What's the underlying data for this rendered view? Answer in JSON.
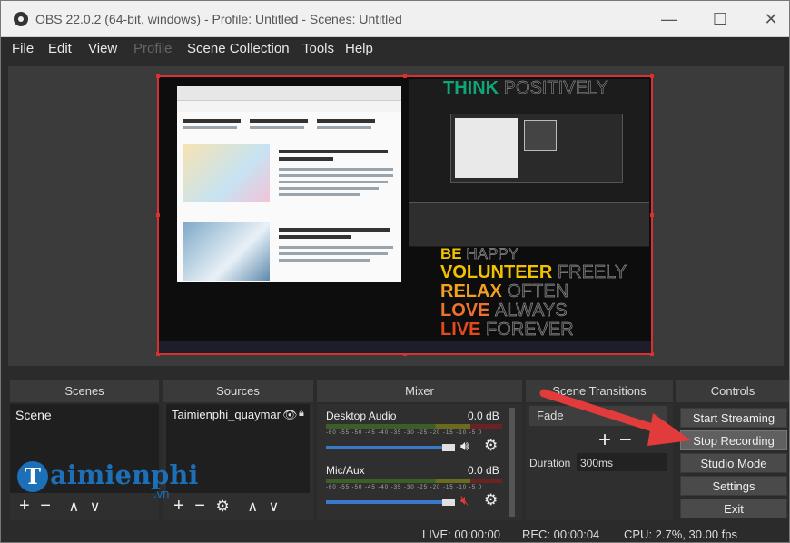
{
  "window": {
    "title": "OBS 22.0.2 (64-bit, windows) - Profile: Untitled - Scenes: Untitled",
    "minimize": "—",
    "maximize": "☐",
    "close": "✕"
  },
  "menu": [
    "File",
    "Edit",
    "View",
    "Profile",
    "Scene Collection",
    "Tools",
    "Help"
  ],
  "preview": {
    "poster_lines": [
      {
        "bold": "THINK",
        "thin": "POSITIVELY"
      },
      {
        "bold": "BE",
        "thin": "HAPPY"
      },
      {
        "bold": "VOLUNTEER",
        "thin": "FREELY"
      },
      {
        "bold": "RELAX",
        "thin": "OFTEN"
      },
      {
        "bold": "LOVE",
        "thin": "ALWAYS"
      },
      {
        "bold": "LIVE",
        "thin": "FOREVER"
      }
    ]
  },
  "docks": {
    "scenes": {
      "header": "Scenes",
      "items": [
        "Scene"
      ]
    },
    "sources": {
      "header": "Sources",
      "items": [
        "Taimienphi_quaymar"
      ]
    },
    "mixer": {
      "header": "Mixer",
      "channels": [
        {
          "name": "Desktop Audio",
          "db": "0.0 dB"
        },
        {
          "name": "Mic/Aux",
          "db": "0.0 dB"
        }
      ],
      "ticks": "-60 -55 -50 -45 -40 -35 -30 -25 -20 -15 -10 -5 0"
    },
    "transitions": {
      "header": "Scene Transitions",
      "selected": "Fade",
      "duration_label": "Duration",
      "duration_value": "300ms"
    },
    "controls": {
      "header": "Controls",
      "buttons": [
        "Start Streaming",
        "Stop Recording",
        "Studio Mode",
        "Settings",
        "Exit"
      ]
    }
  },
  "status": {
    "live": "LIVE: 00:00:00",
    "rec": "REC: 00:00:04",
    "cpu": "CPU: 2.7%, 30.00 fps"
  },
  "watermark": {
    "brand": "aimienphi",
    "suffix": ".vn"
  },
  "colors": {
    "accent_red": "#d93030",
    "arrow": "#e23b3b",
    "slider_blue": "#3a78c8"
  }
}
